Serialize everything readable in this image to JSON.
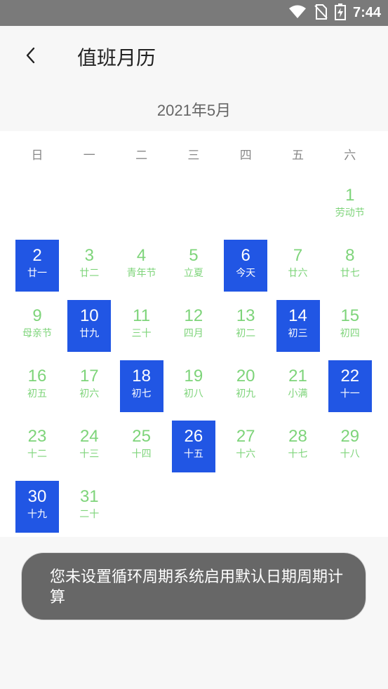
{
  "status_bar": {
    "time": "7:44",
    "icons": [
      "wifi-icon",
      "no-sim-icon",
      "battery-charging-icon"
    ]
  },
  "header": {
    "back_icon": "chevron-left-icon",
    "title": "值班月历"
  },
  "calendar": {
    "month_label": "2021年5月",
    "weekdays": [
      "日",
      "一",
      "二",
      "三",
      "四",
      "五",
      "六"
    ],
    "colors": {
      "normal": "#7ed47a",
      "selected_bg": "#2156e4",
      "selected_text": "#ffffff"
    },
    "first_weekday_index": 6,
    "days": [
      {
        "num": "1",
        "lunar": "劳动节",
        "selected": false
      },
      {
        "num": "2",
        "lunar": "廿一",
        "selected": true
      },
      {
        "num": "3",
        "lunar": "廿二",
        "selected": false
      },
      {
        "num": "4",
        "lunar": "青年节",
        "selected": false
      },
      {
        "num": "5",
        "lunar": "立夏",
        "selected": false
      },
      {
        "num": "6",
        "lunar": "今天",
        "selected": true
      },
      {
        "num": "7",
        "lunar": "廿六",
        "selected": false
      },
      {
        "num": "8",
        "lunar": "廿七",
        "selected": false
      },
      {
        "num": "9",
        "lunar": "母亲节",
        "selected": false
      },
      {
        "num": "10",
        "lunar": "廿九",
        "selected": true
      },
      {
        "num": "11",
        "lunar": "三十",
        "selected": false
      },
      {
        "num": "12",
        "lunar": "四月",
        "selected": false
      },
      {
        "num": "13",
        "lunar": "初二",
        "selected": false
      },
      {
        "num": "14",
        "lunar": "初三",
        "selected": true
      },
      {
        "num": "15",
        "lunar": "初四",
        "selected": false
      },
      {
        "num": "16",
        "lunar": "初五",
        "selected": false
      },
      {
        "num": "17",
        "lunar": "初六",
        "selected": false
      },
      {
        "num": "18",
        "lunar": "初七",
        "selected": true
      },
      {
        "num": "19",
        "lunar": "初八",
        "selected": false
      },
      {
        "num": "20",
        "lunar": "初九",
        "selected": false
      },
      {
        "num": "21",
        "lunar": "小满",
        "selected": false
      },
      {
        "num": "22",
        "lunar": "十一",
        "selected": true
      },
      {
        "num": "23",
        "lunar": "十二",
        "selected": false
      },
      {
        "num": "24",
        "lunar": "十三",
        "selected": false
      },
      {
        "num": "25",
        "lunar": "十四",
        "selected": false
      },
      {
        "num": "26",
        "lunar": "十五",
        "selected": true
      },
      {
        "num": "27",
        "lunar": "十六",
        "selected": false
      },
      {
        "num": "28",
        "lunar": "十七",
        "selected": false
      },
      {
        "num": "29",
        "lunar": "十八",
        "selected": false
      },
      {
        "num": "30",
        "lunar": "十九",
        "selected": true
      },
      {
        "num": "31",
        "lunar": "二十",
        "selected": false
      }
    ]
  },
  "toast": {
    "message": "您未设置循环周期系统启用默认日期周期计算"
  }
}
